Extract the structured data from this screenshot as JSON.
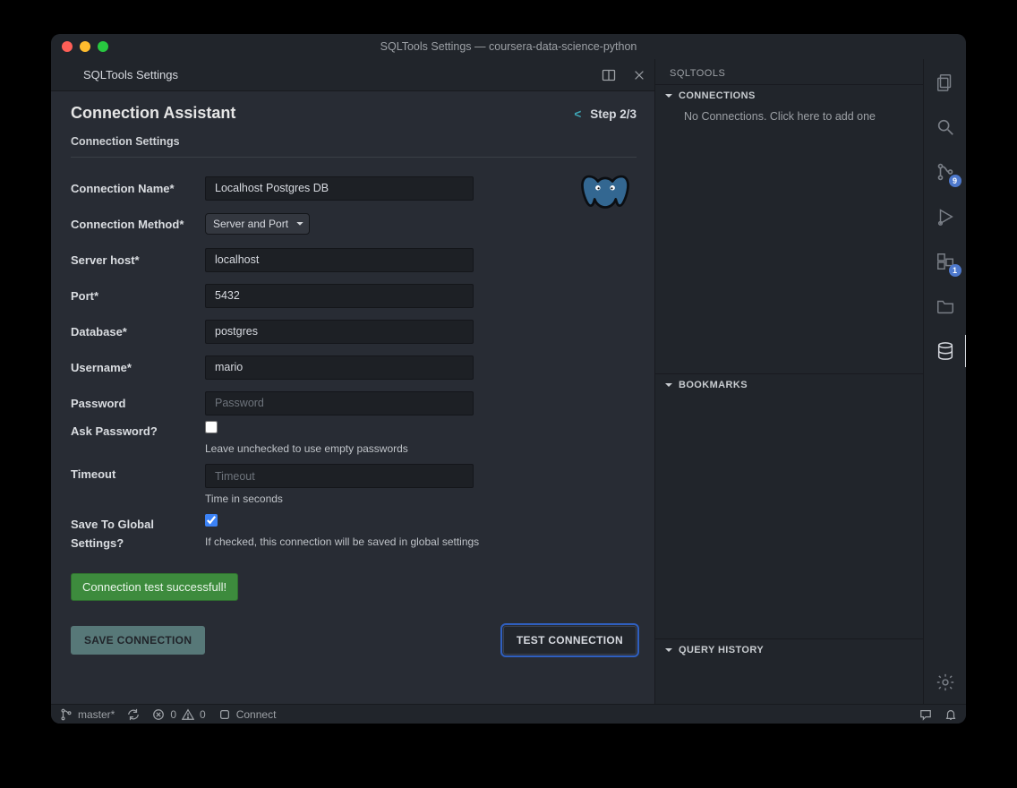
{
  "window": {
    "title": "SQLTools Settings — coursera-data-science-python"
  },
  "tab": {
    "title": "SQLTools Settings"
  },
  "page": {
    "heading": "Connection Assistant",
    "step_prefix": "<",
    "step": "Step 2/3",
    "subheading": "Connection Settings"
  },
  "form": {
    "name": {
      "label": "Connection Name*",
      "value": "Localhost Postgres DB"
    },
    "method": {
      "label": "Connection Method*",
      "value": "Server and Port"
    },
    "host": {
      "label": "Server host*",
      "value": "localhost"
    },
    "port": {
      "label": "Port*",
      "value": "5432"
    },
    "database": {
      "label": "Database*",
      "value": "postgres"
    },
    "username": {
      "label": "Username*",
      "value": "mario"
    },
    "password": {
      "label": "Password",
      "placeholder": "Password"
    },
    "ask": {
      "label": "Ask Password?",
      "hint": "Leave unchecked to use empty passwords"
    },
    "timeout": {
      "label": "Timeout",
      "placeholder": "Timeout",
      "hint": "Time in seconds"
    },
    "global": {
      "label": "Save To Global Settings?",
      "hint": "If checked, this connection will be saved in global settings"
    }
  },
  "banner": "Connection test successfull!",
  "buttons": {
    "save": "SAVE CONNECTION",
    "test": "TEST CONNECTION"
  },
  "sidepanel": {
    "title": "SQLTOOLS",
    "connections": {
      "header": "CONNECTIONS",
      "empty": "No Connections. Click here to add one"
    },
    "bookmarks": {
      "header": "BOOKMARKS"
    },
    "history": {
      "header": "QUERY HISTORY"
    }
  },
  "activity": {
    "source_control_badge": "9",
    "extensions_badge": "1"
  },
  "status": {
    "branch": "master*",
    "errors": "0",
    "warnings": "0",
    "connect": "Connect"
  }
}
